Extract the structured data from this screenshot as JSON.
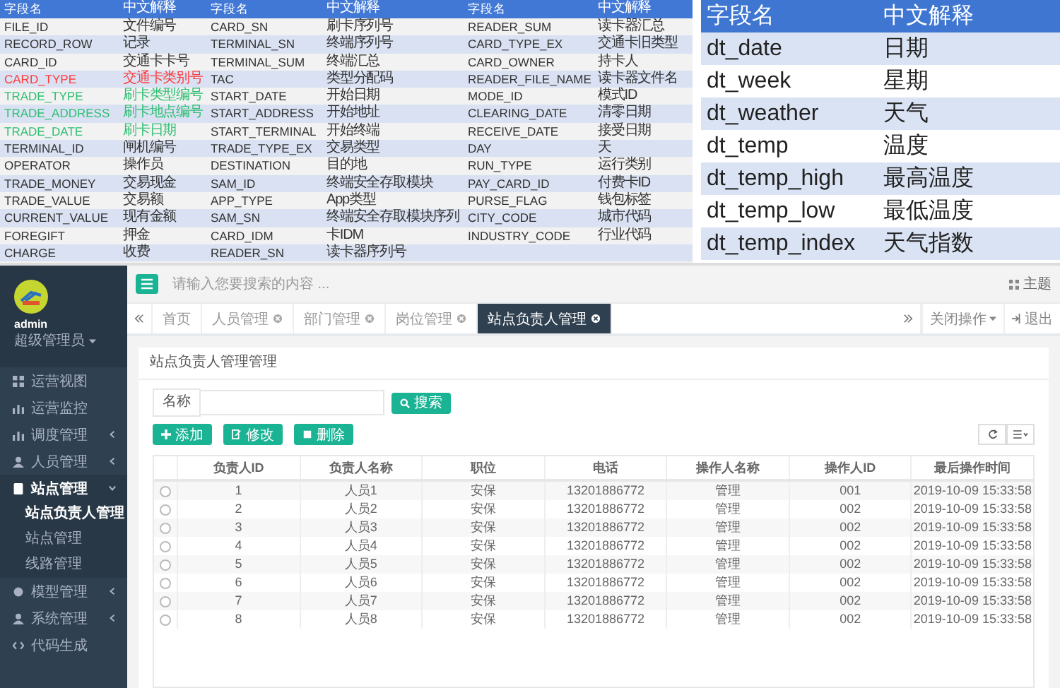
{
  "field_table": {
    "columns": [
      "字段名",
      "中文解释",
      "字段名",
      "中文解释",
      "字段名",
      "中文解释"
    ],
    "rows": [
      {
        "pairs": [
          {
            "field": "FILE_ID",
            "meaning": "文件编号"
          },
          {
            "field": "CARD_SN",
            "meaning": "刷卡序列号"
          },
          {
            "field": "READER_SUM",
            "meaning": "读卡器汇总"
          }
        ]
      },
      {
        "pairs": [
          {
            "field": "RECORD_ROW",
            "meaning": "记录"
          },
          {
            "field": "TERMINAL_SN",
            "meaning": "终端序列号"
          },
          {
            "field": "CARD_TYPE_EX",
            "meaning": "交通卡旧类型"
          }
        ]
      },
      {
        "pairs": [
          {
            "field": "CARD_ID",
            "meaning": "交通卡卡号"
          },
          {
            "field": "TERMINAL_SUM",
            "meaning": "终端汇总"
          },
          {
            "field": "CARD_OWNER",
            "meaning": "持卡人"
          }
        ]
      },
      {
        "pairs": [
          {
            "field": "CARD_TYPE",
            "meaning": "交通卡类别号",
            "color": "#ff3b3b"
          },
          {
            "field": "TAC",
            "meaning": "类型分配码"
          },
          {
            "field": "READER_FILE_NAME",
            "meaning": "读卡器文件名"
          }
        ]
      },
      {
        "pairs": [
          {
            "field": "TRADE_TYPE",
            "meaning": "刷卡类型编号",
            "color": "#2fbf71"
          },
          {
            "field": "START_DATE",
            "meaning": "开始日期"
          },
          {
            "field": "MODE_ID",
            "meaning": "模式ID"
          }
        ]
      },
      {
        "pairs": [
          {
            "field": "TRADE_ADDRESS",
            "meaning": "刷卡地点编号",
            "color": "#2fbf71"
          },
          {
            "field": "START_ADDRESS",
            "meaning": "开始地址"
          },
          {
            "field": "CLEARING_DATE",
            "meaning": "清零日期"
          }
        ]
      },
      {
        "pairs": [
          {
            "field": "TRADE_DATE",
            "meaning": "刷卡日期",
            "color": "#2fbf71"
          },
          {
            "field": "START_TERMINAL",
            "meaning": "开始终端"
          },
          {
            "field": "RECEIVE_DATE",
            "meaning": "接受日期"
          }
        ]
      },
      {
        "pairs": [
          {
            "field": "TERMINAL_ID",
            "meaning": "闸机编号"
          },
          {
            "field": "TRADE_TYPE_EX",
            "meaning": "交易类型"
          },
          {
            "field": "DAY",
            "meaning": "天"
          }
        ]
      },
      {
        "pairs": [
          {
            "field": "OPERATOR",
            "meaning": "操作员"
          },
          {
            "field": "DESTINATION",
            "meaning": "目的地"
          },
          {
            "field": "RUN_TYPE",
            "meaning": "运行类别"
          }
        ]
      },
      {
        "pairs": [
          {
            "field": "TRADE_MONEY",
            "meaning": "交易现金"
          },
          {
            "field": "SAM_ID",
            "meaning": "终端安全存取模块"
          },
          {
            "field": "PAY_CARD_ID",
            "meaning": "付费卡ID"
          }
        ]
      },
      {
        "pairs": [
          {
            "field": "TRADE_VALUE",
            "meaning": "交易额"
          },
          {
            "field": "APP_TYPE",
            "meaning": "App类型"
          },
          {
            "field": "PURSE_FLAG",
            "meaning": "钱包标签"
          }
        ]
      },
      {
        "pairs": [
          {
            "field": "CURRENT_VALUE",
            "meaning": "现有金额"
          },
          {
            "field": "SAM_SN",
            "meaning": "终端安全存取模块序列"
          },
          {
            "field": "CITY_CODE",
            "meaning": "城市代码"
          }
        ]
      },
      {
        "pairs": [
          {
            "field": "FOREGIFT",
            "meaning": "押金"
          },
          {
            "field": "CARD_IDM",
            "meaning": "卡IDM"
          },
          {
            "field": "INDUSTRY_CODE",
            "meaning": "行业代码"
          }
        ]
      },
      {
        "pairs": [
          {
            "field": "CHARGE",
            "meaning": "收费"
          },
          {
            "field": "READER_SN",
            "meaning": "读卡器序列号"
          }
        ]
      }
    ]
  },
  "weather_table": {
    "columns": [
      "字段名",
      "中文解释"
    ],
    "rows": [
      {
        "field": "dt_date",
        "meaning": "日期"
      },
      {
        "field": "dt_week",
        "meaning": "星期"
      },
      {
        "field": "dt_weather",
        "meaning": "天气"
      },
      {
        "field": "dt_temp",
        "meaning": "温度"
      },
      {
        "field": "dt_temp_high",
        "meaning": "最高温度"
      },
      {
        "field": "dt_temp_low",
        "meaning": "最低温度"
      },
      {
        "field": "dt_temp_index",
        "meaning": "天气指数"
      }
    ]
  },
  "admin": {
    "sidebar": {
      "user": "admin",
      "role": "超级管理员",
      "items": [
        {
          "label": "运营视图"
        },
        {
          "label": "运营监控"
        },
        {
          "label": "调度管理",
          "expanded": false
        },
        {
          "label": "人员管理",
          "expanded": false
        },
        {
          "label": "站点管理",
          "expanded": true,
          "children": [
            {
              "label": "站点负责人管理",
              "selected": true
            },
            {
              "label": "站点管理",
              "selected": false
            },
            {
              "label": "线路管理",
              "selected": false
            }
          ]
        },
        {
          "label": "模型管理",
          "expanded": false
        },
        {
          "label": "系统管理",
          "expanded": false
        },
        {
          "label": "代码生成"
        }
      ]
    },
    "search": {
      "placeholder": "请输入您要搜索的内容 ..."
    },
    "theme": "主题",
    "tabs": [
      {
        "label": "首页",
        "selected": false,
        "closable": false
      },
      {
        "label": "人员管理",
        "selected": false,
        "closable": true
      },
      {
        "label": "部门管理",
        "selected": false,
        "closable": true
      },
      {
        "label": "岗位管理",
        "selected": false,
        "closable": true
      },
      {
        "label": "站点负责人管理",
        "selected": true,
        "closable": true
      }
    ],
    "close_ops": "关闭操作",
    "logout": "退出",
    "panel_title": "站点负责人管理管理",
    "filter": {
      "label": "名称",
      "button": "搜索"
    },
    "actions": [
      "添加",
      "修改",
      "删除"
    ],
    "table": {
      "columns": [
        "负责人ID",
        "负责人名称",
        "职位",
        "电话",
        "操作人名称",
        "操作人ID",
        "最后操作时间"
      ],
      "rows": [
        {
          "selected": false,
          "cells": [
            "1",
            "人员1",
            "安保",
            "13201886772",
            "管理",
            "001",
            "2019-10-09 15:33:58"
          ]
        },
        {
          "selected": false,
          "cells": [
            "2",
            "人员2",
            "安保",
            "13201886772",
            "管理",
            "002",
            "2019-10-09 15:33:58"
          ]
        },
        {
          "selected": false,
          "cells": [
            "3",
            "人员3",
            "安保",
            "13201886772",
            "管理",
            "002",
            "2019-10-09 15:33:58"
          ]
        },
        {
          "selected": false,
          "cells": [
            "4",
            "人员4",
            "安保",
            "13201886772",
            "管理",
            "002",
            "2019-10-09 15:33:58"
          ]
        },
        {
          "selected": false,
          "cells": [
            "5",
            "人员5",
            "安保",
            "13201886772",
            "管理",
            "002",
            "2019-10-09 15:33:58"
          ]
        },
        {
          "selected": false,
          "cells": [
            "6",
            "人员6",
            "安保",
            "13201886772",
            "管理",
            "002",
            "2019-10-09 15:33:58"
          ]
        },
        {
          "selected": false,
          "cells": [
            "7",
            "人员7",
            "安保",
            "13201886772",
            "管理",
            "002",
            "2019-10-09 15:33:58"
          ]
        },
        {
          "selected": false,
          "cells": [
            "8",
            "人员8",
            "安保",
            "13201886772",
            "管理",
            "002",
            "2019-10-09 15:33:58"
          ]
        }
      ]
    }
  }
}
